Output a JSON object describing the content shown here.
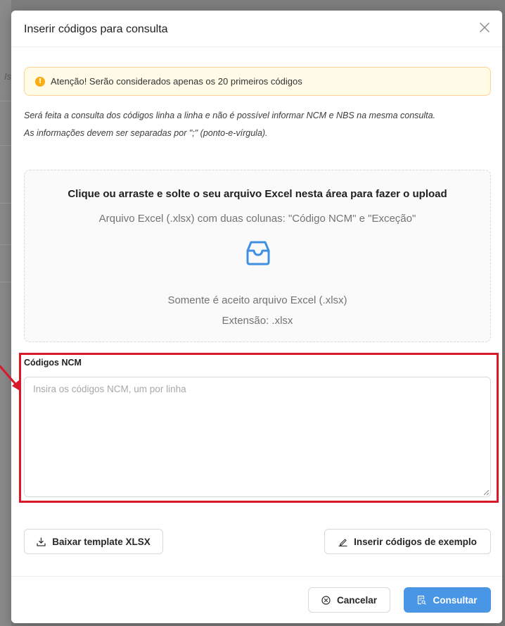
{
  "background": {
    "fragment": "Is"
  },
  "modal": {
    "title": "Inserir códigos para consulta",
    "close_label": "✕"
  },
  "alert": {
    "icon": "!",
    "text": "Atenção! Serão considerados apenas os 20 primeiros códigos",
    "color": "#faad14"
  },
  "info": {
    "line1": "Será feita a consulta dos códigos linha a linha e não é possível informar NCM e NBS na mesma consulta.",
    "line2": "As informações devem ser separadas por \";\" (ponto-e-vírgula)."
  },
  "upload": {
    "title": "Clique ou arraste e solte o seu arquivo Excel nesta área para fazer o upload",
    "hint": "Arquivo Excel (.xlsx) com duas colunas: \"Código NCM\" e \"Exceção\"",
    "icon": "inbox-icon",
    "only_excel": "Somente é aceito arquivo Excel (.xlsx)",
    "extension": "Extensão: .xlsx"
  },
  "codes_field": {
    "label": "Códigos NCM",
    "placeholder": "Insira os códigos NCM, um por linha",
    "value": ""
  },
  "buttons": {
    "download_template": "Baixar template XLSX",
    "insert_example": "Inserir códigos de exemplo",
    "cancel": "Cancelar",
    "submit": "Consultar"
  },
  "colors": {
    "primary": "#4a96e6",
    "highlight": "#d9182a",
    "warning_bg": "#fffbe6",
    "warning_border": "#ffd38f"
  }
}
